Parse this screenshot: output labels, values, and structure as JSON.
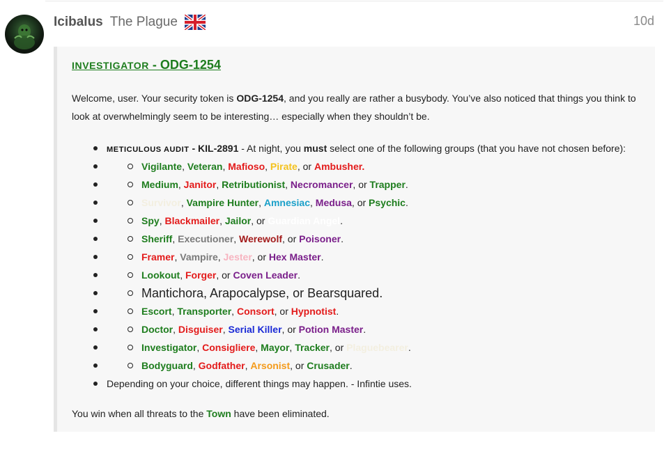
{
  "post": {
    "username": "Icibalus",
    "user_title": "The Plague",
    "flag_icon": "uk-flag-icon",
    "date": "10d"
  },
  "role": {
    "heading_prefix": "INVESTIGATOR",
    "heading_code": " - ODG-1254",
    "intro_pre": "Welcome, user. Your security token is ",
    "intro_token": "ODG-1254",
    "intro_post": ", and you really are rather a busybody. You’ve also noticed that things you think to look at overwhelmingly seem to be interesting… especially when they shouldn’t be.",
    "ability_name": "METICULOUS AUDIT",
    "ability_code": " - KIL-2891",
    "ability_desc_pre": " - At night, you ",
    "ability_desc_must": "must",
    "ability_desc_post": " select one of the following groups (that you have not chosen before):",
    "closing_note": "Depending on your choice, different things may happen. - Infintie uses.",
    "win_pre": "You win when all threats to the ",
    "win_faction": "Town",
    "win_post": " have been eliminated."
  },
  "groups": [
    [
      {
        "t": "Vigilante",
        "c": "g"
      },
      {
        "t": ", ",
        "c": ""
      },
      {
        "t": "Veteran",
        "c": "g"
      },
      {
        "t": ", ",
        "c": ""
      },
      {
        "t": "Mafioso",
        "c": "r"
      },
      {
        "t": ", ",
        "c": ""
      },
      {
        "t": "Pirate",
        "c": "y"
      },
      {
        "t": ", or ",
        "c": ""
      },
      {
        "t": "Ambusher.",
        "c": "r"
      }
    ],
    [
      {
        "t": "Medium",
        "c": "g"
      },
      {
        "t": ", ",
        "c": ""
      },
      {
        "t": "Janitor",
        "c": "r"
      },
      {
        "t": ", ",
        "c": ""
      },
      {
        "t": "Retributionist",
        "c": "g"
      },
      {
        "t": ", ",
        "c": ""
      },
      {
        "t": "Necromancer",
        "c": "p"
      },
      {
        "t": ", or ",
        "c": ""
      },
      {
        "t": "Trapper",
        "c": "g"
      },
      {
        "t": ".",
        "c": ""
      }
    ],
    [
      {
        "t": "Survivor",
        "c": "cr"
      },
      {
        "t": ", ",
        "c": ""
      },
      {
        "t": "Vampire Hunter",
        "c": "g"
      },
      {
        "t": ", ",
        "c": ""
      },
      {
        "t": "Amnesiac",
        "c": "c"
      },
      {
        "t": ", ",
        "c": ""
      },
      {
        "t": "Medusa",
        "c": "p"
      },
      {
        "t": ", or ",
        "c": ""
      },
      {
        "t": "Psychic",
        "c": "g"
      },
      {
        "t": ".",
        "c": ""
      }
    ],
    [
      {
        "t": "Spy",
        "c": "g"
      },
      {
        "t": ", ",
        "c": ""
      },
      {
        "t": "Blackmailer",
        "c": "r"
      },
      {
        "t": ", ",
        "c": ""
      },
      {
        "t": "Jailor",
        "c": "g"
      },
      {
        "t": ", or ",
        "c": ""
      },
      {
        "t": "Guardian Angel",
        "c": "wh"
      },
      {
        "t": ".",
        "c": ""
      }
    ],
    [
      {
        "t": "Sheriff",
        "c": "g"
      },
      {
        "t": ", ",
        "c": ""
      },
      {
        "t": "Executioner",
        "c": "gr"
      },
      {
        "t": ", ",
        "c": ""
      },
      {
        "t": "Werewolf",
        "c": "dr"
      },
      {
        "t": ", or ",
        "c": ""
      },
      {
        "t": "Poisoner",
        "c": "p"
      },
      {
        "t": ".",
        "c": ""
      }
    ],
    [
      {
        "t": "Framer",
        "c": "r"
      },
      {
        "t": ", ",
        "c": ""
      },
      {
        "t": "Vampire",
        "c": "gr"
      },
      {
        "t": ", ",
        "c": ""
      },
      {
        "t": "Jester",
        "c": "pk"
      },
      {
        "t": ", or ",
        "c": ""
      },
      {
        "t": "Hex Master",
        "c": "p"
      },
      {
        "t": ".",
        "c": ""
      }
    ],
    [
      {
        "t": "Lookout",
        "c": "g"
      },
      {
        "t": ", ",
        "c": ""
      },
      {
        "t": "Forger",
        "c": "r"
      },
      {
        "t": ", or ",
        "c": ""
      },
      {
        "t": "Coven Leader",
        "c": "p"
      },
      {
        "t": ".",
        "c": ""
      }
    ],
    [
      {
        "t": "Mantichora, Arapocalypse, or Bearsquared.",
        "c": "big"
      }
    ],
    [
      {
        "t": "Escort",
        "c": "g"
      },
      {
        "t": ", ",
        "c": ""
      },
      {
        "t": "Transporter",
        "c": "g"
      },
      {
        "t": ", ",
        "c": ""
      },
      {
        "t": "Consort",
        "c": "r"
      },
      {
        "t": ", or ",
        "c": ""
      },
      {
        "t": "Hypnotist",
        "c": "r"
      },
      {
        "t": ".",
        "c": ""
      }
    ],
    [
      {
        "t": "Doctor",
        "c": "g"
      },
      {
        "t": ", ",
        "c": ""
      },
      {
        "t": "Disguiser",
        "c": "r"
      },
      {
        "t": ", ",
        "c": ""
      },
      {
        "t": "Serial Killer",
        "c": "bl"
      },
      {
        "t": ", or ",
        "c": ""
      },
      {
        "t": "Potion Master",
        "c": "p"
      },
      {
        "t": ".",
        "c": ""
      }
    ],
    [
      {
        "t": "Investigator",
        "c": "g"
      },
      {
        "t": ", ",
        "c": ""
      },
      {
        "t": "Consigliere",
        "c": "r"
      },
      {
        "t": ", ",
        "c": ""
      },
      {
        "t": "Mayor",
        "c": "g"
      },
      {
        "t": ", ",
        "c": ""
      },
      {
        "t": "Tracker",
        "c": "g"
      },
      {
        "t": ", or ",
        "c": ""
      },
      {
        "t": "Plaguebearer",
        "c": "cr"
      },
      {
        "t": ".",
        "c": ""
      }
    ],
    [
      {
        "t": "Bodyguard",
        "c": "g"
      },
      {
        "t": ", ",
        "c": ""
      },
      {
        "t": "Godfather",
        "c": "r"
      },
      {
        "t": ", ",
        "c": ""
      },
      {
        "t": "Arsonist",
        "c": "o"
      },
      {
        "t": ", or ",
        "c": ""
      },
      {
        "t": "Crusader",
        "c": "g"
      },
      {
        "t": ".",
        "c": ""
      }
    ]
  ],
  "colors": {
    "town": "#1e7d1e",
    "mafia": "#e31b1b",
    "coven": "#7a1f8a",
    "serial_killer": "#1b2bd6",
    "arsonist": "#f49b1b",
    "pirate": "#f4c21d",
    "amnesiac": "#1ba0c9",
    "quote_background": "#f7f7f7"
  }
}
